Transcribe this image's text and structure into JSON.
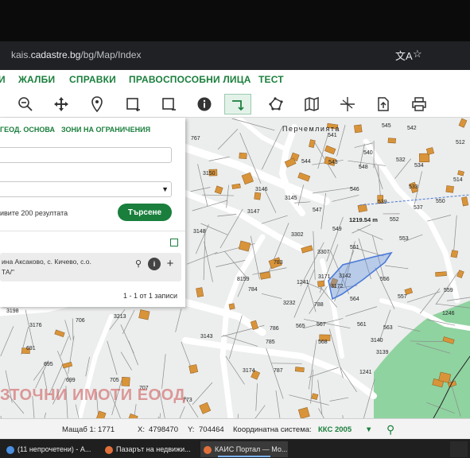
{
  "browser": {
    "url_prefix": "kais.",
    "url_domain": "cadastre.bg",
    "url_path": "/bg/Map/Index",
    "translate_icon": "translate-icon",
    "bookmark_icon": "star-icon"
  },
  "menu": {
    "items": [
      "И",
      "ЖАЛБИ",
      "СПРАВКИ",
      "ПРАВОСПОСОБНИ ЛИЦА",
      "ТЕСТ"
    ]
  },
  "toolbar": {
    "tools": [
      "zoom-out-icon",
      "pan-icon",
      "location-pin-icon",
      "select-rectangle-icon",
      "select-area-icon",
      "info-icon",
      "measure-icon",
      "polygon-icon",
      "map-book-icon",
      "coordinates-icon",
      "export-icon",
      "print-icon"
    ]
  },
  "panel": {
    "tab_geo": "ГЕОД. ОСНОВА",
    "tab_zones": "ЗОНИ НА ОГРАНИЧЕНИЯ",
    "limit_text": "ивите 200 резултата",
    "search_button": "Търсене",
    "result_line1": "ина Аксаково, с. Кичево, с.о.",
    "result_line2": "ТА/\"",
    "result_count": "1 - 1 от 1 записи"
  },
  "map": {
    "place_name": "Перчемлията",
    "parcel_selected": "3142",
    "parcel_label_a": "3171",
    "distance_label": "1219.54 m",
    "labels": [
      [
        "767",
        240,
        176
      ],
      [
        "3150",
        255,
        220
      ],
      [
        "3146",
        321,
        240
      ],
      [
        "3145",
        358,
        251
      ],
      [
        "3147",
        311,
        268
      ],
      [
        "3148",
        243,
        293
      ],
      [
        "3302",
        366,
        297
      ],
      [
        "3307",
        399,
        319
      ],
      [
        "549",
        418,
        290
      ],
      [
        "551",
        440,
        313
      ],
      [
        "547",
        393,
        266
      ],
      [
        "541",
        412,
        172
      ],
      [
        "544",
        379,
        205
      ],
      [
        "543",
        413,
        206
      ],
      [
        "540",
        457,
        194
      ],
      [
        "548",
        451,
        212
      ],
      [
        "546",
        440,
        240
      ],
      [
        "539",
        475,
        256
      ],
      [
        "552",
        490,
        278
      ],
      [
        "553",
        502,
        302
      ],
      [
        "556",
        478,
        353
      ],
      [
        "564",
        440,
        378
      ],
      [
        "557",
        500,
        375
      ],
      [
        "783",
        344,
        332
      ],
      [
        "784",
        312,
        366
      ],
      [
        "8159",
        298,
        353
      ],
      [
        "1241",
        373,
        357
      ],
      [
        "3232",
        356,
        383
      ],
      [
        "788",
        395,
        385
      ],
      [
        "567",
        398,
        410
      ],
      [
        "565",
        372,
        412
      ],
      [
        "568",
        400,
        432
      ],
      [
        "786",
        339,
        415
      ],
      [
        "785",
        334,
        432
      ],
      [
        "787",
        344,
        468
      ],
      [
        "561",
        449,
        410
      ],
      [
        "563",
        482,
        414
      ],
      [
        "3140",
        466,
        430
      ],
      [
        "3139",
        473,
        445
      ],
      [
        "1241",
        452,
        470
      ],
      [
        "3174",
        305,
        468
      ],
      [
        "3143",
        252,
        425
      ],
      [
        "3213",
        143,
        400
      ],
      [
        "3198",
        8,
        393
      ],
      [
        "3176",
        37,
        411
      ],
      [
        "706",
        95,
        405
      ],
      [
        "691",
        33,
        440
      ],
      [
        "695",
        55,
        460
      ],
      [
        "699",
        83,
        480
      ],
      [
        "705",
        138,
        480
      ],
      [
        "707",
        175,
        490
      ],
      [
        "773",
        230,
        505
      ],
      [
        "1246",
        556,
        396
      ],
      [
        "559",
        558,
        367
      ],
      [
        "512",
        573,
        181
      ],
      [
        "514",
        570,
        228
      ],
      [
        "533",
        514,
        237
      ],
      [
        "537",
        520,
        263
      ],
      [
        "550",
        548,
        255
      ],
      [
        "534",
        521,
        210
      ],
      [
        "542",
        512,
        163
      ],
      [
        "545",
        480,
        160
      ],
      [
        "532",
        498,
        203
      ],
      [
        "3172",
        416,
        362
      ]
    ]
  },
  "status": {
    "scale_label": "Мащаб 1:",
    "scale_value": "1771",
    "x_label": "X:",
    "x_value": "4798470",
    "y_label": "Y:",
    "y_value": "704464",
    "coord_label": "Координатна система:",
    "coord_value": "ККС 2005"
  },
  "watermark": "ЗТОЧНИ ИМОТИ ЕООД",
  "taskbar": {
    "tasks": [
      "(11 непрочетени) - А...",
      "Пазарът на недвижи...",
      "КАИС Портал — Мо..."
    ]
  },
  "colors": {
    "accent": "#1a7f3c",
    "selected_parcel": "#5a8de0",
    "green_area": "#8fd3a0"
  }
}
